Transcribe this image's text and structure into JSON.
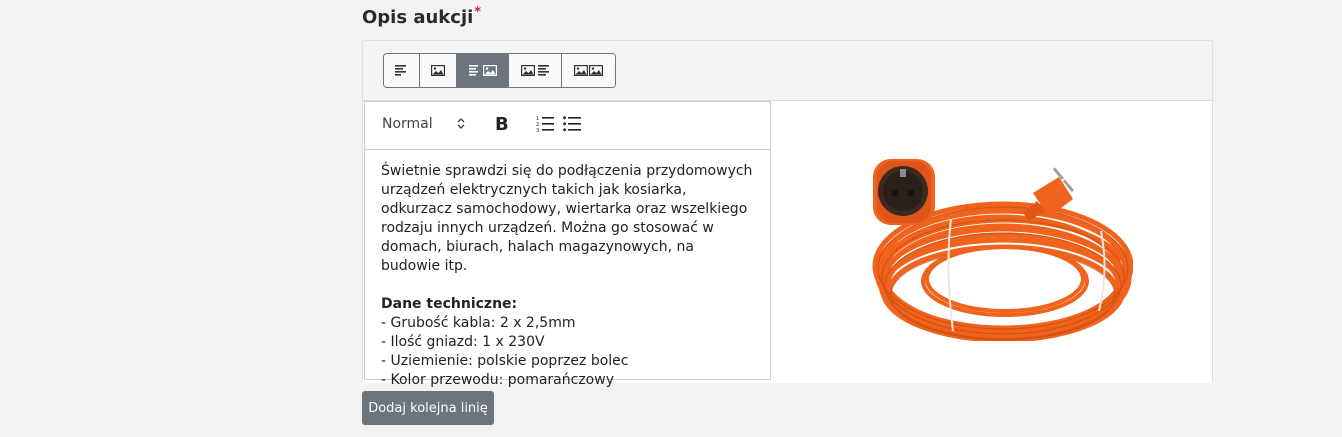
{
  "section": {
    "title": "Opis aukcji",
    "required_marker": "*"
  },
  "layout_options": [
    {
      "name": "text-only",
      "icon": "align-left-icon",
      "active": false
    },
    {
      "name": "image-only",
      "icon": "image-icon",
      "active": false
    },
    {
      "name": "text-image",
      "icon": "text-image-icon",
      "active": true
    },
    {
      "name": "image-text",
      "icon": "image-text-icon",
      "active": false
    },
    {
      "name": "image-image",
      "icon": "two-images-icon",
      "active": false
    }
  ],
  "editor": {
    "format_select": "Normal",
    "toolbar_icons": [
      "bold-icon",
      "ordered-list-icon",
      "bullet-list-icon"
    ],
    "bold_label": "B",
    "paragraph_1": "Świetnie sprawdzi się do podłączenia przydomowych urządzeń elektrycznych takich jak kosiarka, odkurzacz samochodowy, wiertarka oraz wszelkiego rodzaju innych urządzeń. Można go stosować w domach, biurach, halach magazynowych, na budowie itp.",
    "tech_heading": "Dane techniczne:",
    "tech_lines": [
      "- Grubość kabla: 2 x 2,5mm",
      "- Ilość gniazd: 1 x 230V",
      "- Uziemienie: polskie poprzez bolec",
      "- Kolor przewodu: pomarańczowy"
    ]
  },
  "image": {
    "subject": "orange-extension-cord",
    "colors": {
      "cable": "#f0631c",
      "cable_dark": "#c94a10",
      "socket": "#3a2a22"
    }
  },
  "buttons": {
    "add_line": "Dodaj kolejna linię"
  },
  "colors": {
    "button_bg": "#6c757d",
    "required": "#d8202f"
  }
}
